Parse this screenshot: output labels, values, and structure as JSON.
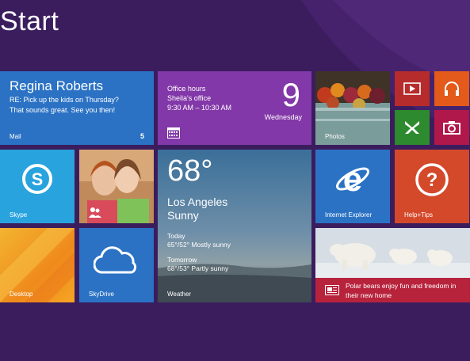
{
  "screen": {
    "title": "Start"
  },
  "tiles": {
    "mail": {
      "sender": "Regina Roberts",
      "preview_line1": "RE: Pick up the kids on Thursday?",
      "preview_line2": "That sounds great. See you then!",
      "label": "Mail",
      "count": "5"
    },
    "calendar": {
      "event_title": "Office hours",
      "event_location": "Sheila's office",
      "event_time": "9:30 AM – 10:30 AM",
      "day_number": "9",
      "weekday": "Wednesday"
    },
    "photos": {
      "label": "Photos"
    },
    "video": {
      "icon": "video-icon"
    },
    "music": {
      "icon": "headphones-icon"
    },
    "games": {
      "icon": "xbox-icon"
    },
    "camera": {
      "icon": "camera-icon"
    },
    "skype": {
      "label": "Skype"
    },
    "people": {
      "icon": "people-icon"
    },
    "weather": {
      "temperature": "68°",
      "city": "Los Angeles",
      "condition": "Sunny",
      "today_label": "Today",
      "today_forecast": "65°/52° Mostly sunny",
      "tomorrow_label": "Tomorrow",
      "tomorrow_forecast": "68°/53° Partly sunny",
      "label": "Weather"
    },
    "ie": {
      "label": "Internet Explorer"
    },
    "help": {
      "label": "Help+Tips"
    },
    "desktop": {
      "label": "Desktop"
    },
    "skydrive": {
      "label": "SkyDrive"
    },
    "news": {
      "headline": "Polar bears enjoy fun and freedom in their new home"
    }
  },
  "colors": {
    "background": "#3b1d5e",
    "mail": "#2b72c4",
    "calendar": "#8238a8",
    "skype": "#28a3de",
    "help": "#d4492a",
    "news_bar": "#b8233c"
  }
}
